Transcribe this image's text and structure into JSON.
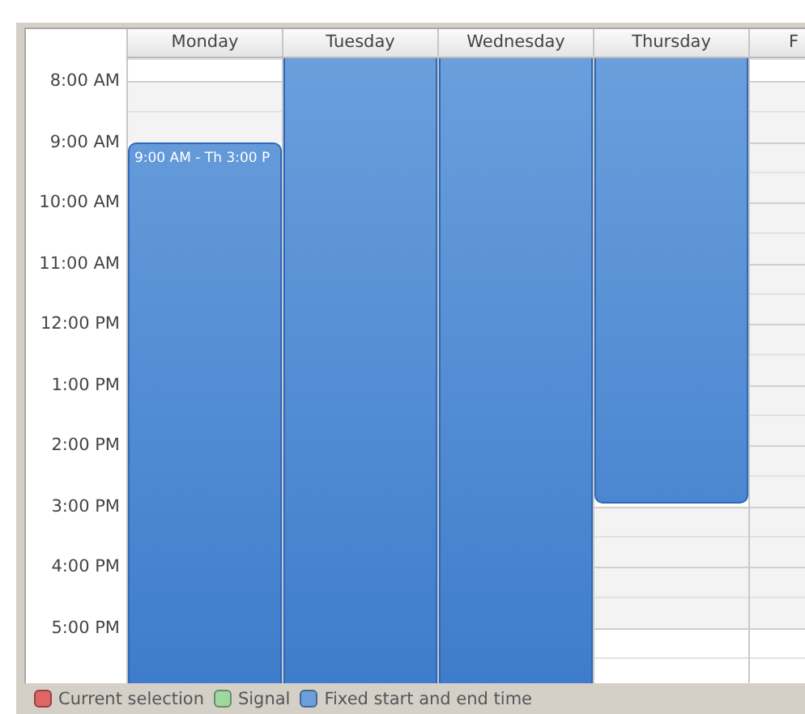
{
  "days": [
    {
      "label": "Monday",
      "event_label": "9:00 AM - Th 3:00 P"
    },
    {
      "label": "Tuesday"
    },
    {
      "label": "Wednesday"
    },
    {
      "label": "Thursday"
    },
    {
      "label": "F"
    }
  ],
  "time_rows": [
    {
      "booked": [
        false,
        true,
        true,
        true,
        false
      ]
    },
    {
      "label": "8:00 AM",
      "booked": [
        false,
        true,
        true,
        true,
        false
      ]
    },
    {
      "label": "9:00 AM",
      "booked": [
        true,
        true,
        true,
        true,
        false
      ]
    },
    {
      "label": "10:00 AM",
      "booked": [
        true,
        true,
        true,
        true,
        false
      ]
    },
    {
      "label": "11:00 AM",
      "booked": [
        true,
        true,
        true,
        true,
        false
      ]
    },
    {
      "label": "12:00 PM",
      "booked": [
        true,
        true,
        true,
        true,
        false
      ]
    },
    {
      "label": "1:00 PM",
      "booked": [
        true,
        true,
        true,
        true,
        false
      ]
    },
    {
      "label": "2:00 PM",
      "booked": [
        true,
        true,
        true,
        true,
        false
      ]
    },
    {
      "label": "3:00 PM",
      "booked": [
        true,
        true,
        true,
        false,
        false
      ]
    },
    {
      "label": "4:00 PM",
      "booked": [
        true,
        true,
        true,
        false,
        false
      ]
    },
    {
      "label": "5:00 PM",
      "booked": [
        true,
        true,
        true,
        false,
        false
      ]
    }
  ],
  "legend": [
    {
      "label": "Current selection",
      "color": "#e06666"
    },
    {
      "label": "Signal",
      "color": "#9fd89f"
    },
    {
      "label": "Fixed start and end time",
      "color": "#6d9fdc"
    }
  ]
}
